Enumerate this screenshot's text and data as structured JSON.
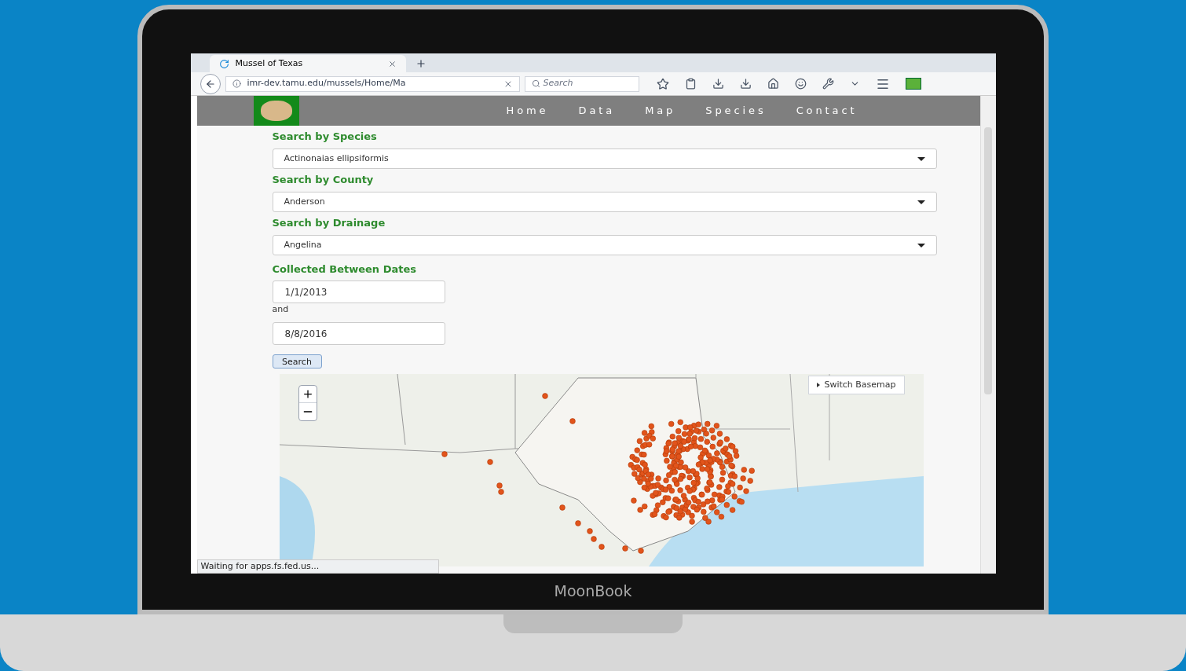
{
  "browser": {
    "tab": {
      "title": "Mussel of Texas"
    },
    "address": "imr-dev.tamu.edu/mussels/Home/Ma",
    "search": {
      "placeholder": "Search"
    }
  },
  "nav": {
    "items": [
      {
        "label": "Home"
      },
      {
        "label": "Data"
      },
      {
        "label": "Map"
      },
      {
        "label": "Species"
      },
      {
        "label": "Contact"
      }
    ]
  },
  "filters": [
    {
      "label": "Search by Species",
      "value": "Actinonaias ellipsiformis"
    },
    {
      "label": "Search by County",
      "value": "Anderson"
    },
    {
      "label": "Search by Drainage",
      "value": "Angelina"
    }
  ],
  "dates": {
    "label": "Collected Between Dates",
    "from": "1/1/2013",
    "joiner": "and",
    "to": "8/8/2016"
  },
  "search_button": "Search",
  "map": {
    "basemap_button": "Switch Basemap"
  },
  "status_bar": "Waiting for apps.fs.fed.us...",
  "device_label": "MoonBook"
}
